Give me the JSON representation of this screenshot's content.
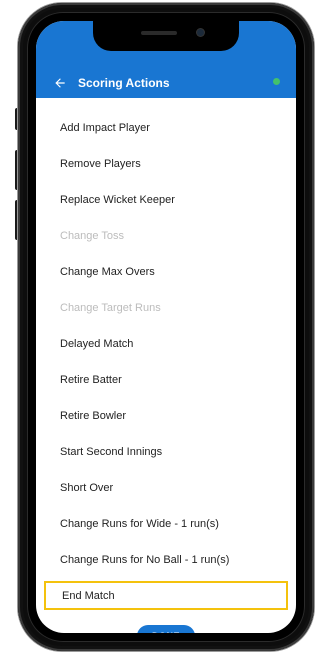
{
  "header": {
    "title": "Scoring Actions",
    "back_icon": "arrow-left-icon",
    "background_color": "#1976d2",
    "status_color": "#43c26b"
  },
  "actions": [
    {
      "label": "Add Impact Player",
      "enabled": true
    },
    {
      "label": "Remove Players",
      "enabled": true
    },
    {
      "label": "Replace Wicket Keeper",
      "enabled": true
    },
    {
      "label": "Change Toss",
      "enabled": false
    },
    {
      "label": "Change Max Overs",
      "enabled": true
    },
    {
      "label": "Change Target Runs",
      "enabled": false
    },
    {
      "label": "Delayed Match",
      "enabled": true
    },
    {
      "label": "Retire Batter",
      "enabled": true
    },
    {
      "label": "Retire Bowler",
      "enabled": true
    },
    {
      "label": "Start Second Innings",
      "enabled": true
    },
    {
      "label": "Short Over",
      "enabled": true
    },
    {
      "label": "Change Runs for Wide - 1 run(s)",
      "enabled": true
    },
    {
      "label": "Change Runs for No Ball - 1 run(s)",
      "enabled": true
    },
    {
      "label": "End Match",
      "enabled": true,
      "highlighted": true
    }
  ],
  "highlight_color": "#f4c20d",
  "footer": {
    "done_label": "DONE",
    "done_color": "#1976d2"
  }
}
